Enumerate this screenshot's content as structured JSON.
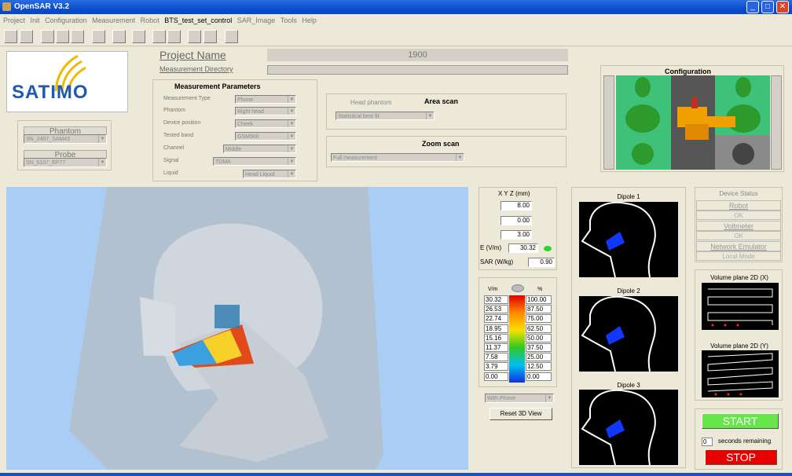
{
  "window": {
    "title": "OpenSAR V3.2"
  },
  "menu": [
    "Project",
    "Init",
    "Configuration",
    "Measurement",
    "Robot",
    "BTS_test_set_control",
    "SAR_Image",
    "Tools",
    "Help"
  ],
  "brand": {
    "logo": "SATIMO"
  },
  "project": {
    "name_label": "Project Name",
    "name_value": "1900",
    "dir_label": "Measurement Directory",
    "dir_value": ""
  },
  "params": {
    "title": "Measurement Parameters",
    "rows": [
      {
        "label": "Measurement Type",
        "value": "Phone"
      },
      {
        "label": "Phantom",
        "value": "Right head"
      },
      {
        "label": "Device position",
        "value": "Cheek"
      },
      {
        "label": "Tested band",
        "value": "GSM900"
      },
      {
        "label": "Channel",
        "value": "Middle"
      },
      {
        "label": "Signal",
        "value": "TDMA"
      },
      {
        "label": "Liquid",
        "value": "Head Liquid"
      }
    ]
  },
  "phantom": {
    "label": "Phantom",
    "value": "SN_2407_SAM43"
  },
  "probe": {
    "label": "Probe",
    "value": "SN_5107_EP77"
  },
  "area_scan": {
    "left_label": "Head phantom",
    "title": "Area scan",
    "value": "Statistical best fit"
  },
  "zoom_scan": {
    "title": "Zoom scan",
    "value": "Full measurement"
  },
  "configuration": {
    "title": "Configuration"
  },
  "xyz": {
    "title": "X Y Z (mm)",
    "x": "8.00",
    "y": "0.00",
    "z": "3.00",
    "e_label": "E (V/m)",
    "e_value": "30.32",
    "sar_label": "SAR (W/kg)",
    "sar_value": "0.90"
  },
  "scale": {
    "vm_label": "V/m",
    "pct_label": "%",
    "vm": [
      "30.32",
      "26.53",
      "22.74",
      "18.95",
      "15.16",
      "11.37",
      "7.58",
      "3.79",
      "0.00"
    ],
    "pct": [
      "100.00",
      "87.50",
      "75.00",
      "62.50",
      "50.00",
      "37.50",
      "25.00",
      "12.50",
      "0.00"
    ]
  },
  "view_mode": "With Phone",
  "reset_button": "Reset 3D View",
  "dipoles": [
    "Dipole 1",
    "Dipole 2",
    "Dipole 3"
  ],
  "device_status": {
    "title": "Device Status",
    "items": [
      {
        "name": "Robot",
        "state": "OK"
      },
      {
        "name": "Voltmeter",
        "state": "OK"
      },
      {
        "name": "Network Emulator",
        "state": "Local Mode"
      }
    ]
  },
  "volume_x": "Volume plane 2D (X)",
  "volume_y": "Volume plane 2D (Y)",
  "controls": {
    "start": "START",
    "stop": "STOP",
    "seconds_value": "0",
    "seconds_label": "seconds remaining"
  },
  "colors": {
    "start": "#66e64a",
    "stop": "#e60000",
    "title_blue": "#0a4ed0"
  }
}
